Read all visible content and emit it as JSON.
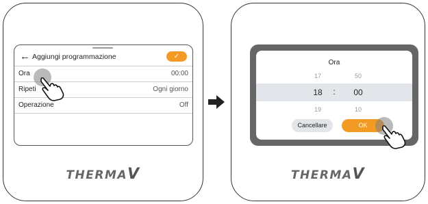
{
  "step1": {
    "header": {
      "title": "Aggiungi programmazione",
      "back_icon": "←",
      "confirm_icon": "✓"
    },
    "rows": [
      {
        "label": "Ora",
        "value": "00:00"
      },
      {
        "label": "Ripeti",
        "value": "Ogni giorno"
      },
      {
        "label": "Operazione",
        "value": "Off"
      }
    ]
  },
  "step2": {
    "dialog": {
      "title": "Ora",
      "hours": {
        "prev": "17",
        "selected": "18",
        "next": "19"
      },
      "minutes": {
        "prev": "50",
        "selected": "00",
        "next": "10"
      },
      "separator": ":",
      "cancel_label": "Cancellare",
      "ok_label": "OK"
    }
  },
  "brand": {
    "logo_text": "THERMA",
    "logo_v": "V"
  },
  "colors": {
    "accent": "#f39a24",
    "overlay": "#666666",
    "band": "#e2e5ea"
  }
}
